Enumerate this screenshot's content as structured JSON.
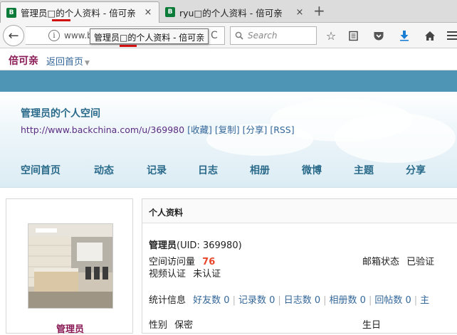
{
  "browser": {
    "tabs": [
      {
        "title": "管理员□的个人资料 - 倍可亲",
        "close": "×",
        "favicon": "B"
      },
      {
        "title": "ryu□的个人资料 - 倍可亲",
        "close": "×",
        "favicon": "B"
      }
    ],
    "new_tab": "+",
    "back": "←",
    "info": "i",
    "url": "www.backc",
    "reload": "C",
    "search_placeholder": "Search",
    "tooltip": "管理员□的个人资料 - 倍可亲",
    "icons": [
      "bookmark-star-icon",
      "reading-list-icon",
      "pocket-icon",
      "download-icon",
      "home-icon",
      "menu-icon"
    ]
  },
  "site": {
    "logo": "倍可亲",
    "home_link": "返回首页",
    "accent": "#8a1a55",
    "band_color": "#4d94b5"
  },
  "header": {
    "title": "管理员的个人空间",
    "url": "http://www.backchina.com/u/369980",
    "actions": [
      "[收藏]",
      "[复制]",
      "[分享]",
      "[RSS]"
    ],
    "nav": [
      "空间首页",
      "动态",
      "记录",
      "日志",
      "相册",
      "微博",
      "主题",
      "分享"
    ]
  },
  "profile": {
    "name": "管理员",
    "panel_title": "个人资料",
    "uid_text": "(UID: 369980)",
    "visits_label": "空间访问量",
    "visits_value": "76",
    "email_label": "邮箱状态",
    "email_value": "已验证",
    "video_label": "视频认证",
    "video_value": "未认证",
    "stats_label": "统计信息",
    "stats": [
      "好友数 0",
      "记录数 0",
      "日志数 0",
      "相册数 0",
      "回帖数 0",
      "主"
    ],
    "gender_label": "性别",
    "gender_value": "保密",
    "birthday_label": "生日"
  }
}
